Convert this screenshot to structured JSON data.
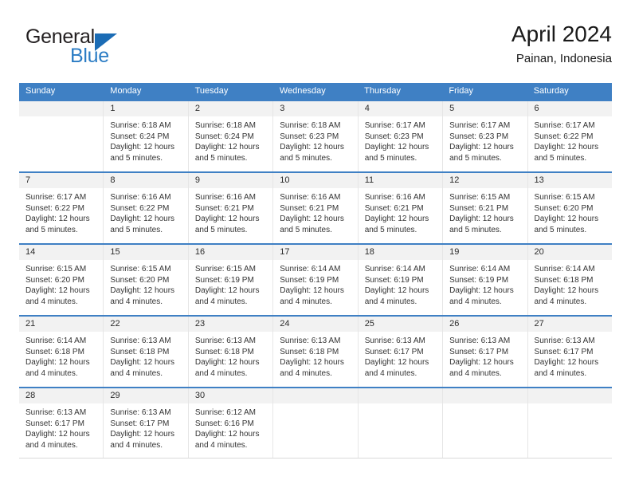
{
  "brand": {
    "word1": "General",
    "word2": "Blue",
    "logo_icon": "triangle-logo-icon"
  },
  "header": {
    "title": "April 2024",
    "location": "Painan, Indonesia"
  },
  "colors": {
    "header_blue": "#3f80c4",
    "brand_blue": "#2b7cc4",
    "daynum_bg": "#f2f2f2",
    "text": "#333333"
  },
  "weekdays": [
    "Sunday",
    "Monday",
    "Tuesday",
    "Wednesday",
    "Thursday",
    "Friday",
    "Saturday"
  ],
  "weeks": [
    [
      {
        "day": "",
        "lines": []
      },
      {
        "day": "1",
        "lines": [
          "Sunrise: 6:18 AM",
          "Sunset: 6:24 PM",
          "Daylight: 12 hours",
          "and 5 minutes."
        ]
      },
      {
        "day": "2",
        "lines": [
          "Sunrise: 6:18 AM",
          "Sunset: 6:24 PM",
          "Daylight: 12 hours",
          "and 5 minutes."
        ]
      },
      {
        "day": "3",
        "lines": [
          "Sunrise: 6:18 AM",
          "Sunset: 6:23 PM",
          "Daylight: 12 hours",
          "and 5 minutes."
        ]
      },
      {
        "day": "4",
        "lines": [
          "Sunrise: 6:17 AM",
          "Sunset: 6:23 PM",
          "Daylight: 12 hours",
          "and 5 minutes."
        ]
      },
      {
        "day": "5",
        "lines": [
          "Sunrise: 6:17 AM",
          "Sunset: 6:23 PM",
          "Daylight: 12 hours",
          "and 5 minutes."
        ]
      },
      {
        "day": "6",
        "lines": [
          "Sunrise: 6:17 AM",
          "Sunset: 6:22 PM",
          "Daylight: 12 hours",
          "and 5 minutes."
        ]
      }
    ],
    [
      {
        "day": "7",
        "lines": [
          "Sunrise: 6:17 AM",
          "Sunset: 6:22 PM",
          "Daylight: 12 hours",
          "and 5 minutes."
        ]
      },
      {
        "day": "8",
        "lines": [
          "Sunrise: 6:16 AM",
          "Sunset: 6:22 PM",
          "Daylight: 12 hours",
          "and 5 minutes."
        ]
      },
      {
        "day": "9",
        "lines": [
          "Sunrise: 6:16 AM",
          "Sunset: 6:21 PM",
          "Daylight: 12 hours",
          "and 5 minutes."
        ]
      },
      {
        "day": "10",
        "lines": [
          "Sunrise: 6:16 AM",
          "Sunset: 6:21 PM",
          "Daylight: 12 hours",
          "and 5 minutes."
        ]
      },
      {
        "day": "11",
        "lines": [
          "Sunrise: 6:16 AM",
          "Sunset: 6:21 PM",
          "Daylight: 12 hours",
          "and 5 minutes."
        ]
      },
      {
        "day": "12",
        "lines": [
          "Sunrise: 6:15 AM",
          "Sunset: 6:21 PM",
          "Daylight: 12 hours",
          "and 5 minutes."
        ]
      },
      {
        "day": "13",
        "lines": [
          "Sunrise: 6:15 AM",
          "Sunset: 6:20 PM",
          "Daylight: 12 hours",
          "and 5 minutes."
        ]
      }
    ],
    [
      {
        "day": "14",
        "lines": [
          "Sunrise: 6:15 AM",
          "Sunset: 6:20 PM",
          "Daylight: 12 hours",
          "and 4 minutes."
        ]
      },
      {
        "day": "15",
        "lines": [
          "Sunrise: 6:15 AM",
          "Sunset: 6:20 PM",
          "Daylight: 12 hours",
          "and 4 minutes."
        ]
      },
      {
        "day": "16",
        "lines": [
          "Sunrise: 6:15 AM",
          "Sunset: 6:19 PM",
          "Daylight: 12 hours",
          "and 4 minutes."
        ]
      },
      {
        "day": "17",
        "lines": [
          "Sunrise: 6:14 AM",
          "Sunset: 6:19 PM",
          "Daylight: 12 hours",
          "and 4 minutes."
        ]
      },
      {
        "day": "18",
        "lines": [
          "Sunrise: 6:14 AM",
          "Sunset: 6:19 PM",
          "Daylight: 12 hours",
          "and 4 minutes."
        ]
      },
      {
        "day": "19",
        "lines": [
          "Sunrise: 6:14 AM",
          "Sunset: 6:19 PM",
          "Daylight: 12 hours",
          "and 4 minutes."
        ]
      },
      {
        "day": "20",
        "lines": [
          "Sunrise: 6:14 AM",
          "Sunset: 6:18 PM",
          "Daylight: 12 hours",
          "and 4 minutes."
        ]
      }
    ],
    [
      {
        "day": "21",
        "lines": [
          "Sunrise: 6:14 AM",
          "Sunset: 6:18 PM",
          "Daylight: 12 hours",
          "and 4 minutes."
        ]
      },
      {
        "day": "22",
        "lines": [
          "Sunrise: 6:13 AM",
          "Sunset: 6:18 PM",
          "Daylight: 12 hours",
          "and 4 minutes."
        ]
      },
      {
        "day": "23",
        "lines": [
          "Sunrise: 6:13 AM",
          "Sunset: 6:18 PM",
          "Daylight: 12 hours",
          "and 4 minutes."
        ]
      },
      {
        "day": "24",
        "lines": [
          "Sunrise: 6:13 AM",
          "Sunset: 6:18 PM",
          "Daylight: 12 hours",
          "and 4 minutes."
        ]
      },
      {
        "day": "25",
        "lines": [
          "Sunrise: 6:13 AM",
          "Sunset: 6:17 PM",
          "Daylight: 12 hours",
          "and 4 minutes."
        ]
      },
      {
        "day": "26",
        "lines": [
          "Sunrise: 6:13 AM",
          "Sunset: 6:17 PM",
          "Daylight: 12 hours",
          "and 4 minutes."
        ]
      },
      {
        "day": "27",
        "lines": [
          "Sunrise: 6:13 AM",
          "Sunset: 6:17 PM",
          "Daylight: 12 hours",
          "and 4 minutes."
        ]
      }
    ],
    [
      {
        "day": "28",
        "lines": [
          "Sunrise: 6:13 AM",
          "Sunset: 6:17 PM",
          "Daylight: 12 hours",
          "and 4 minutes."
        ]
      },
      {
        "day": "29",
        "lines": [
          "Sunrise: 6:13 AM",
          "Sunset: 6:17 PM",
          "Daylight: 12 hours",
          "and 4 minutes."
        ]
      },
      {
        "day": "30",
        "lines": [
          "Sunrise: 6:12 AM",
          "Sunset: 6:16 PM",
          "Daylight: 12 hours",
          "and 4 minutes."
        ]
      },
      {
        "day": "",
        "lines": []
      },
      {
        "day": "",
        "lines": []
      },
      {
        "day": "",
        "lines": []
      },
      {
        "day": "",
        "lines": []
      }
    ]
  ]
}
